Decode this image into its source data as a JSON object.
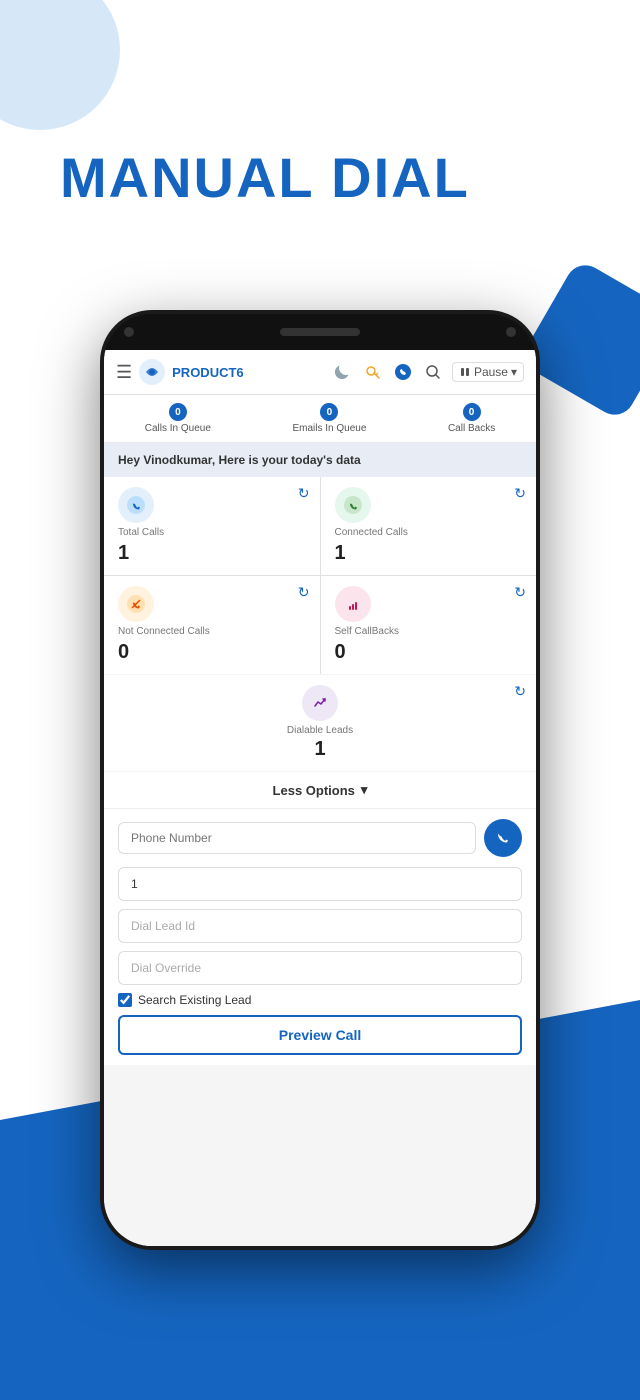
{
  "page": {
    "title": "MANUAL DIAL",
    "background": {
      "circle_color": "#d6e8f8",
      "accent_color": "#1565c0"
    }
  },
  "header": {
    "brand_name": "PRODUCT6",
    "info_icon": "ℹ",
    "moon_icon": "🌙",
    "key_icon": "🔑",
    "phone_icon": "📞",
    "search_icon": "🔍",
    "pause_label": "Pause",
    "pause_chevron": "▾"
  },
  "queue_stats": [
    {
      "badge": "0",
      "label": "Calls In Queue"
    },
    {
      "badge": "0",
      "label": "Emails In Queue"
    },
    {
      "badge": "0",
      "label": "Call Backs"
    }
  ],
  "greeting": "Hey Vinodkumar, Here is your today's data",
  "stats": [
    {
      "label": "Total Calls",
      "value": "1",
      "icon_type": "blue",
      "icon": "📞"
    },
    {
      "label": "Connected Calls",
      "value": "1",
      "icon_type": "green",
      "icon": "📞"
    },
    {
      "label": "Not Connected Calls",
      "value": "0",
      "icon_type": "orange",
      "icon": "📞"
    },
    {
      "label": "Self CallBacks",
      "value": "0",
      "icon_type": "pink",
      "icon": "📊"
    }
  ],
  "dialable_leads": {
    "label": "Dialable Leads",
    "value": "1",
    "icon": "📈"
  },
  "options_section": {
    "toggle_label": "Less Options",
    "toggle_icon": "▾"
  },
  "phone_number_input": {
    "placeholder": "Phone Number"
  },
  "form": {
    "number_value": "1",
    "number_placeholder": "",
    "dial_lead_id_placeholder": "Dial Lead Id",
    "dial_override_placeholder": "Dial Override",
    "search_existing_label": "Search Existing Lead",
    "search_existing_checked": true,
    "preview_call_label": "Preview Call"
  }
}
